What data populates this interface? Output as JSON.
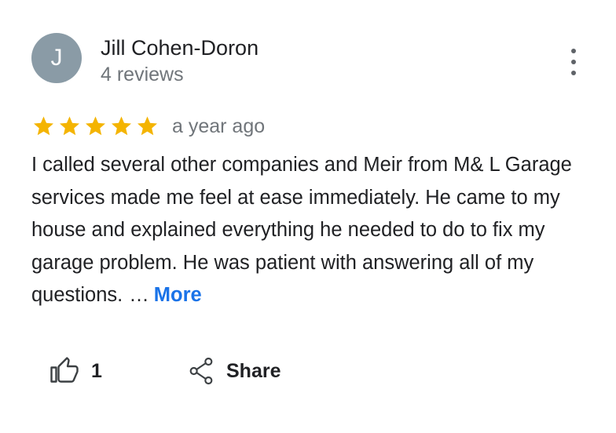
{
  "review": {
    "author": {
      "initial": "J",
      "name": "Jill Cohen-Doron",
      "reviews": "4 reviews"
    },
    "rating": 5,
    "stars_color": "#f4b400",
    "timestamp": "a year ago",
    "text": "I called several other companies and Meir from M& L Garage services made me feel at ease immediately. He came to my house and explained everything he needed to do to fix my garage problem. He was patient with answering all of my questions.",
    "ellipsis": "…",
    "more_label": "More",
    "more_color": "#1a73e8"
  },
  "actions": {
    "like_icon": "thumbs-up-icon",
    "like_count": "1",
    "share_icon": "share-icon",
    "share_label": "Share"
  },
  "menu": {
    "icon": "more-vert-icon"
  }
}
